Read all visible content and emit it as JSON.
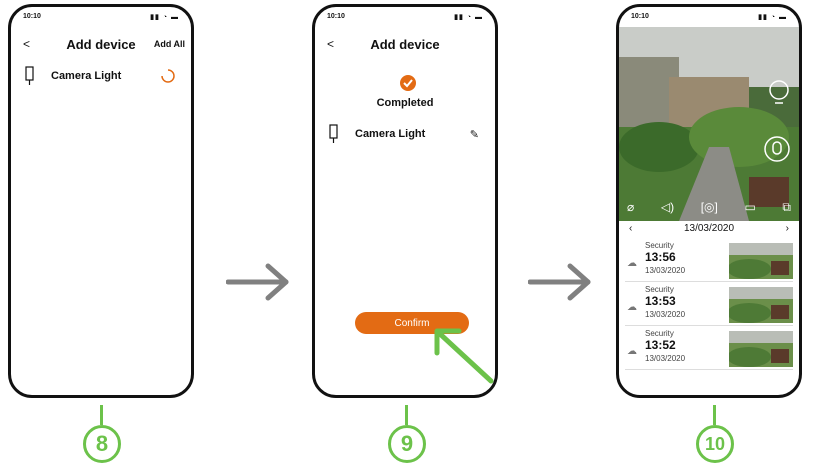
{
  "screen8": {
    "status_time": "10:10",
    "back": "<",
    "title": "Add device",
    "add_all": "Add All",
    "device_name": "Camera Light"
  },
  "screen9": {
    "status_time": "10:10",
    "back": "<",
    "title": "Add device",
    "completed": "Completed",
    "device_name": "Camera Light",
    "confirm": "Confirm"
  },
  "screen10": {
    "status_time": "10:10",
    "date": "13/03/2020",
    "records": [
      {
        "label": "Security",
        "time": "13:56",
        "date": "13/03/2020"
      },
      {
        "label": "Security",
        "time": "13:53",
        "date": "13/03/2020"
      },
      {
        "label": "Security",
        "time": "13:52",
        "date": "13/03/2020"
      }
    ]
  },
  "steps": [
    "8",
    "9",
    "10"
  ],
  "colors": {
    "accent": "#e36b14",
    "step": "#6cc24a",
    "arrow": "#808080"
  }
}
